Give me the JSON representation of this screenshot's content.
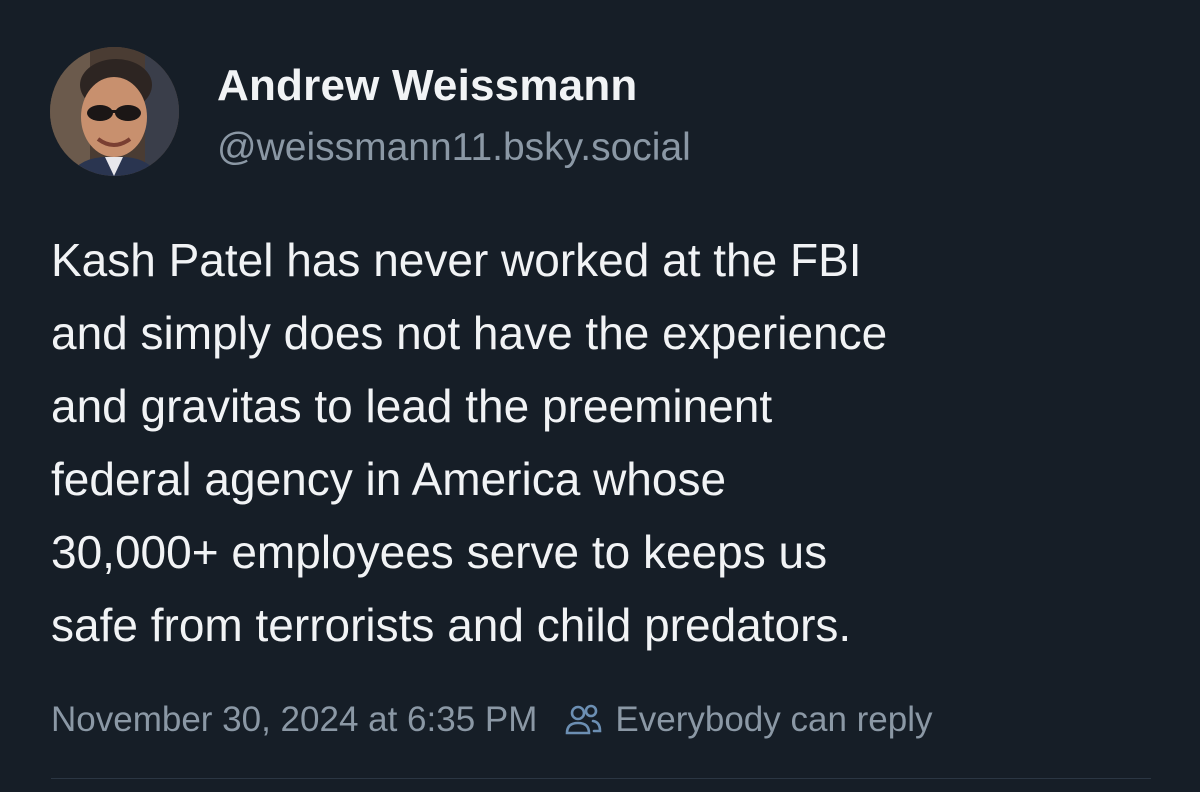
{
  "post": {
    "author": {
      "display_name": "Andrew Weissmann",
      "handle": "@weissmann11.bsky.social"
    },
    "text": "Kash Patel has never worked at the FBI\nand simply does not have the experience\nand gravitas to lead the preeminent\nfederal agency in America whose\n30,000+ employees serve to keeps us\nsafe from terrorists and child predators.",
    "timestamp": "November 30, 2024 at 6:35 PM",
    "reply_setting": {
      "icon": "people-icon",
      "label": "Everybody can reply"
    }
  },
  "colors": {
    "background": "#161e27",
    "text_primary": "#f1f3f5",
    "text_secondary": "#8b98a5",
    "icon_accent": "#6c8fb3"
  }
}
